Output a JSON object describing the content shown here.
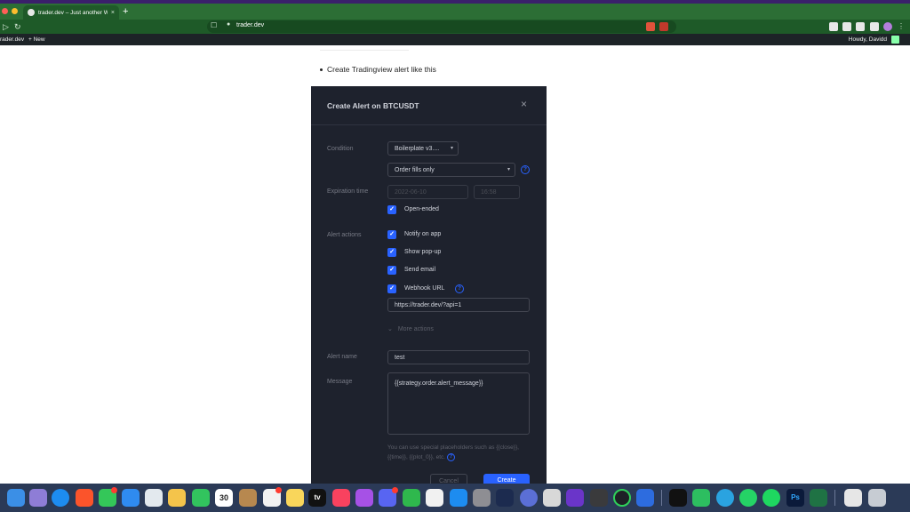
{
  "browser": {
    "tab_title": "trader.dev – Just another Word…",
    "tab_close": "×",
    "new_tab": "+",
    "url": "trader.dev",
    "nav_back": "◁",
    "nav_forward": "▷",
    "nav_reload": "↻"
  },
  "wp_admin_bar": {
    "site": "rader.dev",
    "new": "+ New",
    "greeting": "Howdy, Davidd"
  },
  "page": {
    "bullet": "Create Tradingview alert like this"
  },
  "dialog": {
    "title": "Create Alert on BTCUSDT",
    "close": "×",
    "condition_label": "Condition",
    "condition_value": "Boilerplate v3....",
    "trigger_value": "Order fills only",
    "help": "?",
    "caret": "▾",
    "expiration_label": "Expiration time",
    "expiration_date": "2022-06-10",
    "expiration_time": "16:58",
    "open_ended": "Open-ended",
    "alert_actions_label": "Alert actions",
    "check": "✓",
    "actions": {
      "notify": "Notify on app",
      "popup": "Show pop-up",
      "email": "Send email",
      "webhook": "Webhook URL"
    },
    "webhook_url": "https://trader.dev/?api=1",
    "more_actions": "More actions",
    "more_chevron": "⌄",
    "alert_name_label": "Alert name",
    "alert_name_value": "test",
    "message_label": "Message",
    "message_value": "{{strategy.order.alert_message}}",
    "hint": "You can use special placeholders such as {{close}}, {{time}}, {{plot_0}}, etc.",
    "cancel": "Cancel",
    "create": "Create"
  },
  "dock": {
    "calendar_day": "30",
    "tv_label": "tv",
    "ps_label": "Ps"
  },
  "colors": {
    "tabbar": "#2c6e35",
    "dialog_bg": "#1e222d",
    "accent": "#2962ff"
  }
}
